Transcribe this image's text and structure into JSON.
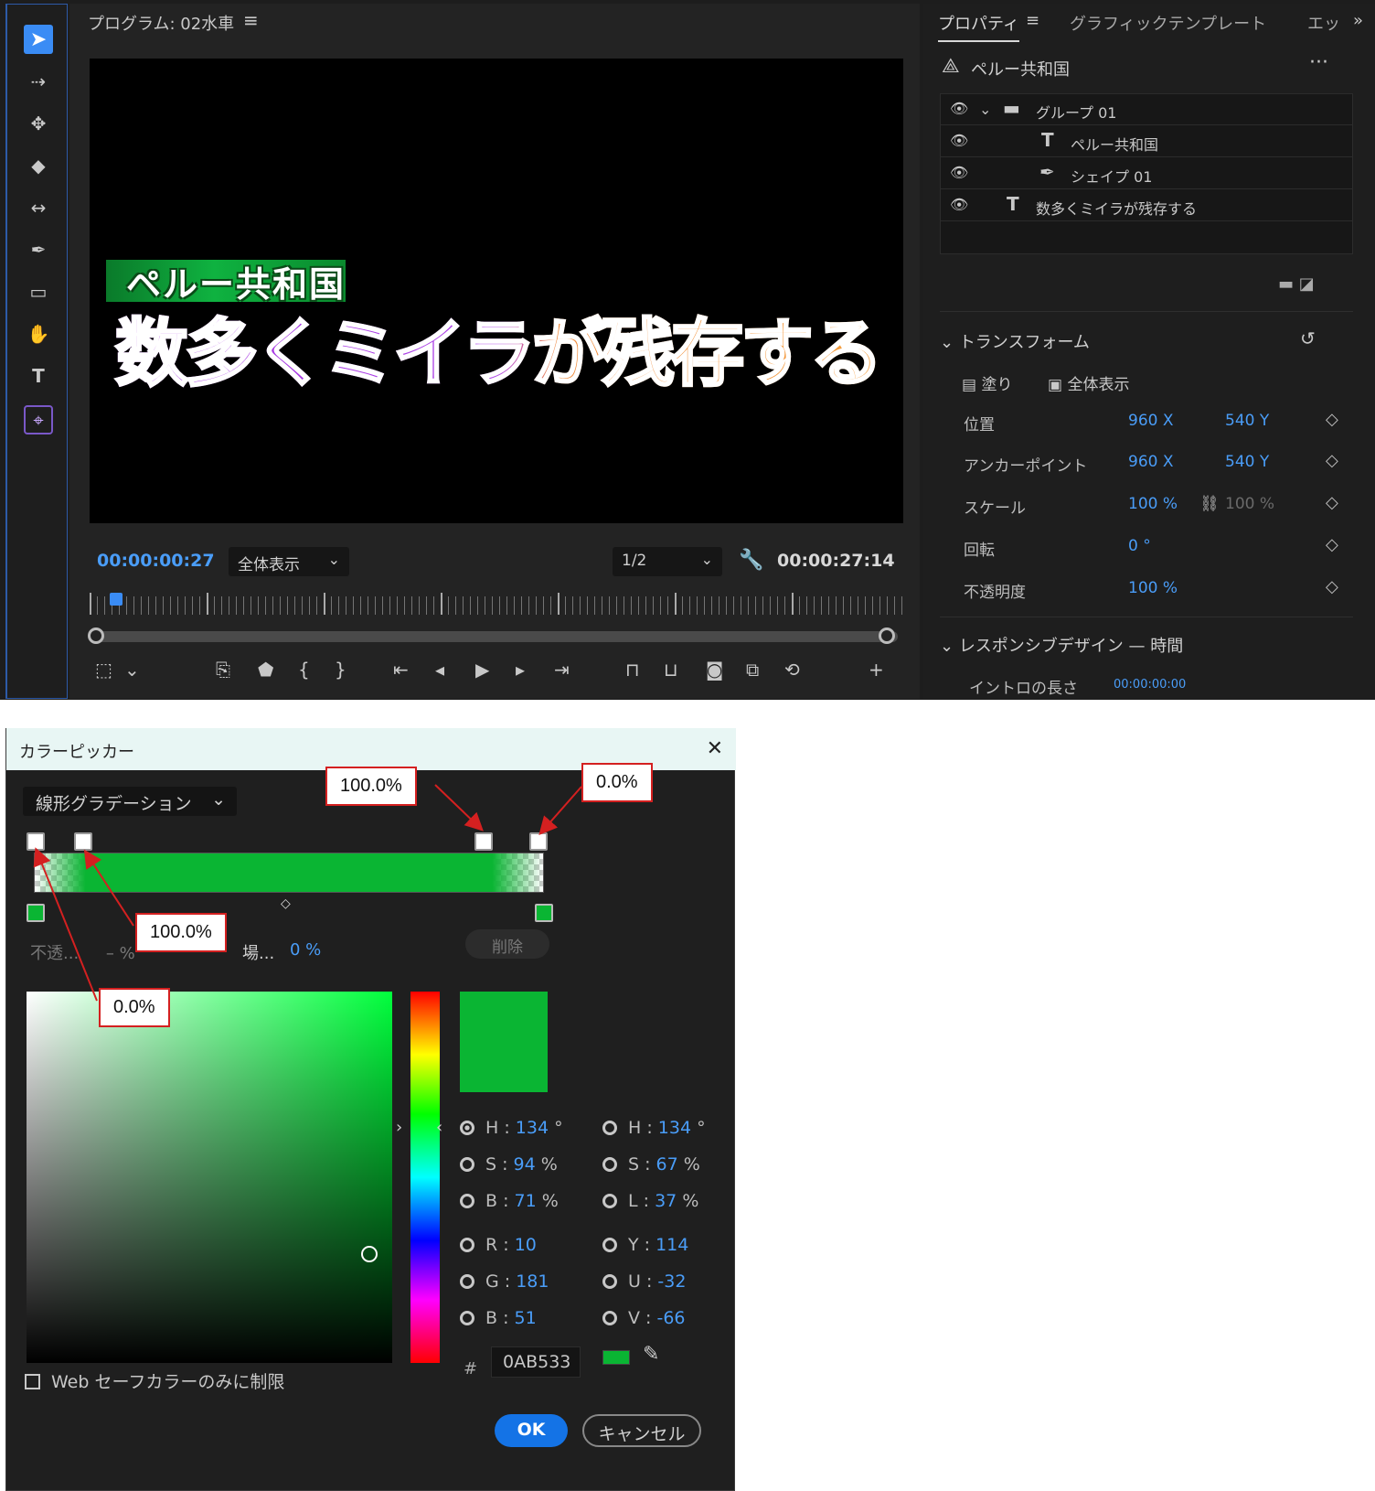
{
  "program_monitor": {
    "title": "プログラム: 02水車",
    "menu_icon": "hamburger-icon",
    "video": {
      "title_text": "ペルー共和国",
      "subtitle_text": "数多くミイラが残存する",
      "colors": {
        "green": "#0fb240",
        "purple": "#a02ae0",
        "orange": "#f5a040"
      }
    },
    "current_timecode": "00:00:00:27",
    "zoom_select": "全体表示",
    "resolution_select": "1/2",
    "duration_timecode": "00:00:27:14"
  },
  "tools": [
    "selection-icon",
    "track-select-icon",
    "ripple-edit-icon",
    "razor-icon",
    "slip-icon",
    "pen-icon",
    "rectangle-icon",
    "hand-icon",
    "type-icon",
    "track-text-icon"
  ],
  "properties": {
    "tabs": [
      "プロパティ",
      "グラフィックテンプレート",
      "エッ"
    ],
    "clip_name": "ペルー共和国",
    "layers": [
      {
        "label": "グループ 01",
        "icon": "folder-icon"
      },
      {
        "label": "ペルー共和国",
        "icon": "text-layer-icon"
      },
      {
        "label": "シェイプ 01",
        "icon": "pen-shape-icon"
      },
      {
        "label": "数多くミイラが残存する",
        "icon": "text-layer-icon"
      }
    ],
    "transform_label": "トランスフォーム",
    "fill_label": "塗り",
    "fit_label": "全体表示",
    "rows": [
      {
        "label": "位置",
        "v1": "960 X",
        "v2": "540 Y"
      },
      {
        "label": "アンカーポイント",
        "v1": "960 X",
        "v2": "540 Y"
      },
      {
        "label": "スケール",
        "v1": "100 %",
        "v2": "100 %"
      },
      {
        "label": "回転",
        "v1": "0 °",
        "v2": ""
      },
      {
        "label": "不透明度",
        "v1": "100 %",
        "v2": ""
      }
    ],
    "responsive_label": "レスポンシブデザイン — 時間",
    "intro_label": "イントロの長さ",
    "intro_value": "00:00:00:00"
  },
  "color_picker": {
    "title": "カラーピッカー",
    "gradient_type": "線形グラデーション",
    "opacity_label": "不透...",
    "opacity_value": "– %",
    "location_label": "場...",
    "location_value": "0 %",
    "delete_label": "削除",
    "hsb": [
      {
        "k": "H",
        "v": "134",
        "u": "°"
      },
      {
        "k": "S",
        "v": "94",
        "u": "%"
      },
      {
        "k": "B",
        "v": "71",
        "u": "%"
      }
    ],
    "hsl": [
      {
        "k": "H",
        "v": "134",
        "u": "°"
      },
      {
        "k": "S",
        "v": "67",
        "u": "%"
      },
      {
        "k": "L",
        "v": "37",
        "u": "%"
      }
    ],
    "rgb": [
      {
        "k": "R",
        "v": "10"
      },
      {
        "k": "G",
        "v": "181"
      },
      {
        "k": "B",
        "v": "51"
      }
    ],
    "yuv": [
      {
        "k": "Y",
        "v": "114"
      },
      {
        "k": "U",
        "v": "-32"
      },
      {
        "k": "V",
        "v": "-66"
      }
    ],
    "hex_prefix": "#",
    "hex": "0AB533",
    "color": "#0ab533",
    "websafe_label": "Web セーフカラーのみに制限",
    "ok_label": "OK",
    "cancel_label": "キャンセル"
  },
  "callouts": [
    "100.0%",
    "0.0%",
    "100.0%",
    "0.0%"
  ]
}
